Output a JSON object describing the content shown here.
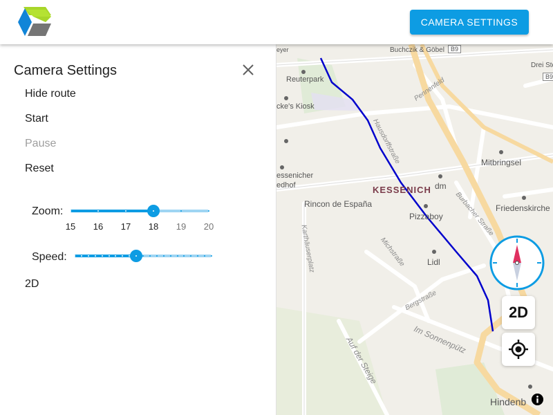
{
  "header": {
    "logo": "app-logo",
    "camera_button_label": "CAMERA SETTINGS"
  },
  "panel": {
    "title": "Camera Settings",
    "close_icon": "close-icon",
    "items": {
      "hide_route": "Hide route",
      "start": "Start",
      "pause": "Pause",
      "reset": "Reset",
      "mode": "2D"
    },
    "zoom": {
      "label": "Zoom:",
      "ticks": [
        "15",
        "16",
        "17",
        "18",
        "19",
        "20"
      ],
      "min": 15,
      "max": 20,
      "value": 18
    },
    "speed": {
      "label": "Speed:",
      "value_fraction": 0.45
    }
  },
  "map": {
    "labels": {
      "buchczik": "Buchczik & Göbel",
      "b9_top": "B9",
      "b9_right": "B9",
      "drei_steine": "Drei Ste",
      "reuterpark": "Reuterpark",
      "kiosk": "cke's Kiosk",
      "mitbringsel": "Mitbringsel",
      "kessenich": "KESSENICH",
      "dm": "dm",
      "essenicher": "essenicher",
      "edhof": "edhof",
      "rincon": "Rincon de España",
      "friedenskirche": "Friedenskirche",
      "pizzaboy": "Pizzaboy",
      "lidl": "Lidl",
      "sonnenputz": "Im Sonnenpütz",
      "auf_der_steige": "Auf der Steige",
      "hindenburg": "Hindenb",
      "meyer": "eyer",
      "bergstrasse": "Bergstraße",
      "michstrasse": "Michstraße",
      "hausdorffstrasse": "Hausdorffstraße",
      "burbacher": "Burbacher Straße",
      "karthauserplatz": "Karthäuserplatz",
      "pennenfeld": "Pennenfeld"
    },
    "compass_icon": "compass-icon",
    "mode_button": "2D",
    "locate_icon": "locate-icon",
    "info_icon": "info-icon",
    "colors": {
      "route": "#0000cc",
      "main_road": "#f7d9a0",
      "accent": "#0d9ce3"
    }
  }
}
